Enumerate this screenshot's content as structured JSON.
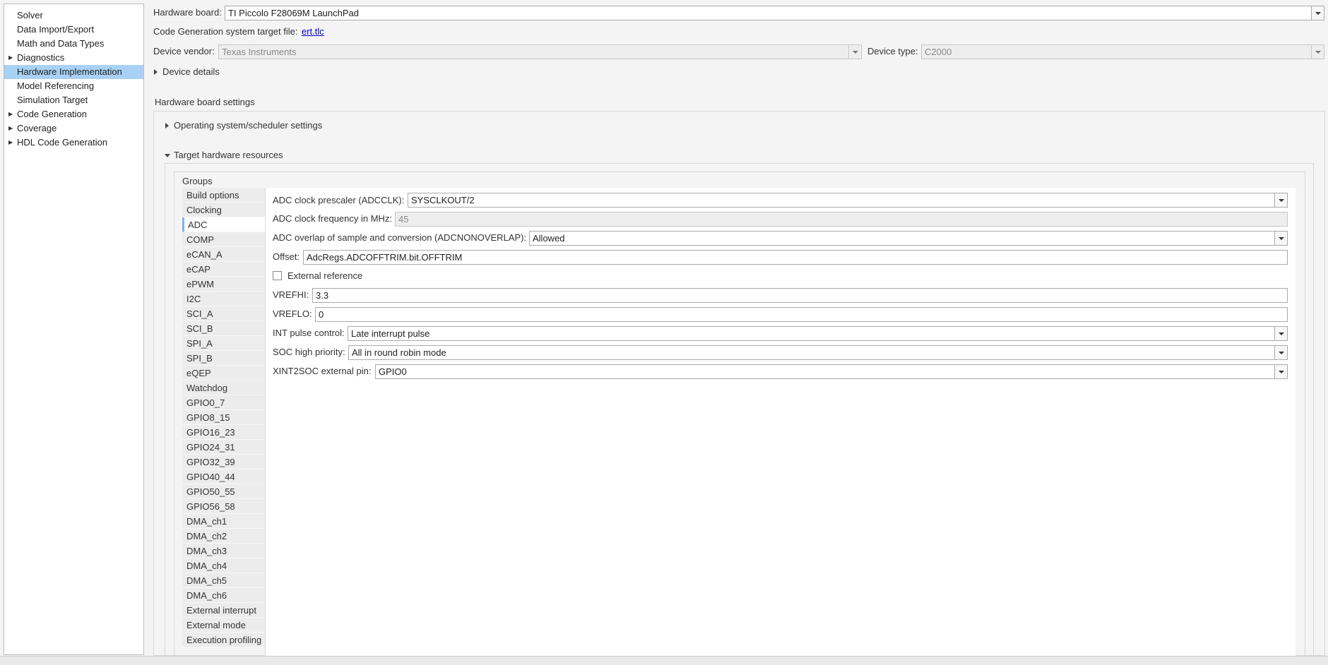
{
  "tree": {
    "items": [
      {
        "label": "Solver",
        "expandable": false,
        "selected": false
      },
      {
        "label": "Data Import/Export",
        "expandable": false,
        "selected": false
      },
      {
        "label": "Math and Data Types",
        "expandable": false,
        "selected": false
      },
      {
        "label": "Diagnostics",
        "expandable": true,
        "selected": false
      },
      {
        "label": "Hardware Implementation",
        "expandable": false,
        "selected": true
      },
      {
        "label": "Model Referencing",
        "expandable": false,
        "selected": false
      },
      {
        "label": "Simulation Target",
        "expandable": false,
        "selected": false
      },
      {
        "label": "Code Generation",
        "expandable": true,
        "selected": false
      },
      {
        "label": "Coverage",
        "expandable": true,
        "selected": false
      },
      {
        "label": "HDL Code Generation",
        "expandable": true,
        "selected": false
      }
    ]
  },
  "hardware": {
    "board_label": "Hardware board:",
    "board_value": "TI Piccolo F28069M LaunchPad",
    "target_file_label": "Code Generation system target file:",
    "target_file_link": "ert.tlc",
    "vendor_label": "Device vendor:",
    "vendor_value": "Texas Instruments",
    "type_label": "Device type:",
    "type_value": "C2000",
    "device_details": "Device details"
  },
  "board_settings": {
    "title": "Hardware board settings",
    "os_section": "Operating system/scheduler settings",
    "target_section": "Target hardware resources",
    "groups_title": "Groups",
    "groups": [
      "Build options",
      "Clocking",
      "ADC",
      "COMP",
      "eCAN_A",
      "eCAP",
      "ePWM",
      "I2C",
      "SCI_A",
      "SCI_B",
      "SPI_A",
      "SPI_B",
      "eQEP",
      "Watchdog",
      "GPIO0_7",
      "GPIO8_15",
      "GPIO16_23",
      "GPIO24_31",
      "GPIO32_39",
      "GPIO40_44",
      "GPIO50_55",
      "GPIO56_58",
      "DMA_ch1",
      "DMA_ch2",
      "DMA_ch3",
      "DMA_ch4",
      "DMA_ch5",
      "DMA_ch6",
      "External interrupt",
      "External mode",
      "Execution profiling"
    ],
    "active_group": "ADC"
  },
  "adc": {
    "prescaler_label": "ADC clock prescaler (ADCCLK):",
    "prescaler_value": "SYSCLKOUT/2",
    "freq_label": "ADC clock frequency in MHz:",
    "freq_value": "45",
    "overlap_label": "ADC overlap of sample and conversion (ADCNONOVERLAP):",
    "overlap_value": "Allowed",
    "offset_label": "Offset:",
    "offset_value": "AdcRegs.ADCOFFTRIM.bit.OFFTRIM",
    "ext_ref_label": "External reference",
    "vrefhi_label": "VREFHI:",
    "vrefhi_value": "3.3",
    "vreflo_label": "VREFLO:",
    "vreflo_value": "0",
    "int_pulse_label": "INT pulse control:",
    "int_pulse_value": "Late interrupt pulse",
    "soc_label": "SOC high priority:",
    "soc_value": "All in round robin mode",
    "xint_label": "XINT2SOC external pin:",
    "xint_value": "GPIO0"
  }
}
